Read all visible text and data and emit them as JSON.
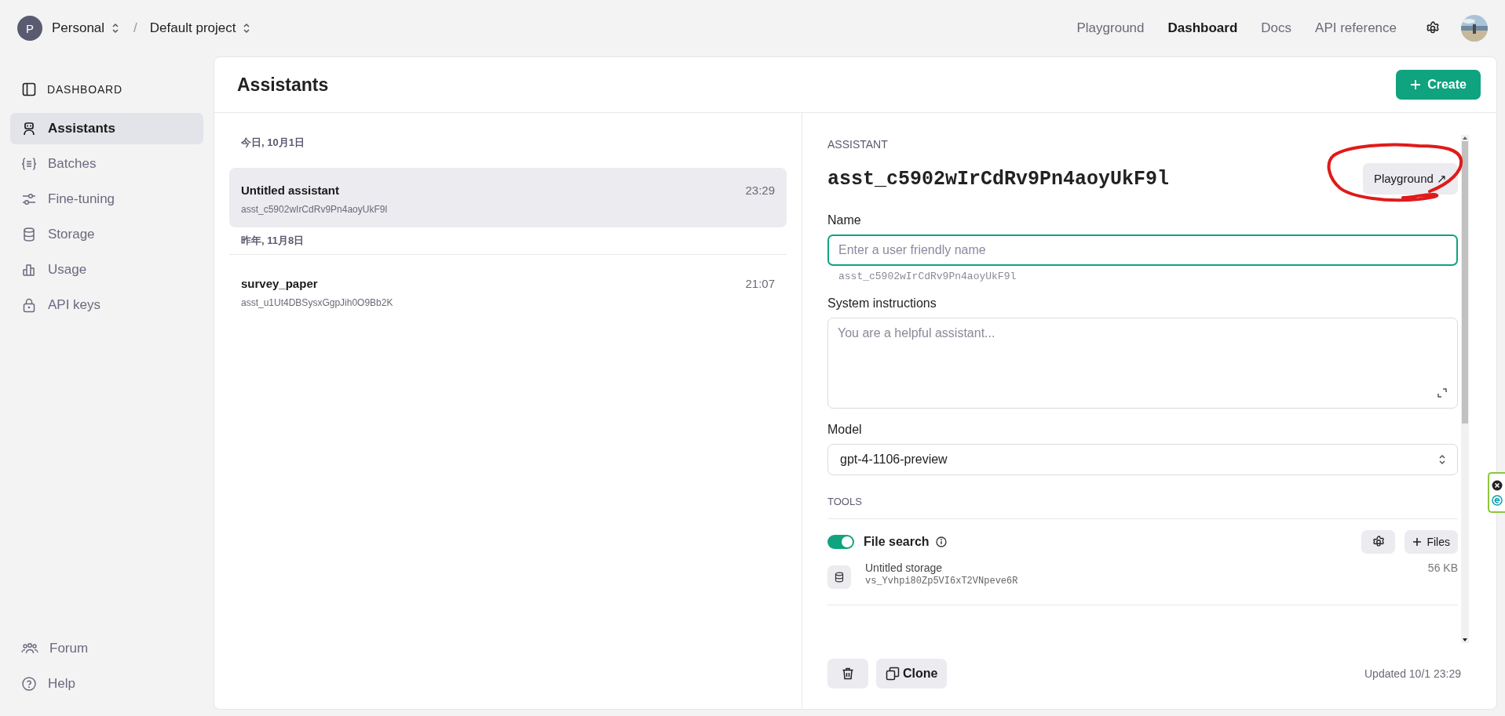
{
  "topbar": {
    "org_initial": "P",
    "org": "Personal",
    "separator": "/",
    "project": "Default project",
    "nav": [
      {
        "label": "Playground",
        "selected": false
      },
      {
        "label": "Dashboard",
        "selected": true
      },
      {
        "label": "Docs",
        "selected": false
      },
      {
        "label": "API reference",
        "selected": false
      }
    ]
  },
  "sidebar": {
    "title": "DASHBOARD",
    "items": [
      {
        "label": "Assistants",
        "selected": true
      },
      {
        "label": "Batches",
        "selected": false
      },
      {
        "label": "Fine-tuning",
        "selected": false
      },
      {
        "label": "Storage",
        "selected": false
      },
      {
        "label": "Usage",
        "selected": false
      },
      {
        "label": "API keys",
        "selected": false
      }
    ],
    "footer_items": [
      "Forum",
      "Help"
    ]
  },
  "page": {
    "title": "Assistants",
    "create_button": "Create"
  },
  "assistant_groups": [
    {
      "date": "今日, 10月1日",
      "items": [
        {
          "name": "Untitled assistant",
          "id": "asst_c5902wIrCdRv9Pn4aoyUkF9l",
          "time": "23:29",
          "selected": true
        }
      ]
    },
    {
      "date": "昨年, 11月8日",
      "items": [
        {
          "name": "survey_paper",
          "id": "asst_u1Ut4DBSysxGgpJih0O9Bb2K",
          "time": "21:07",
          "selected": false
        }
      ]
    }
  ],
  "detail": {
    "eyebrow": "ASSISTANT",
    "id": "asst_c5902wIrCdRv9Pn4aoyUkF9l",
    "playground_button": "Playground ↗",
    "name_label": "Name",
    "name_placeholder": "Enter a user friendly name",
    "name_hint": "asst_c5902wIrCdRv9Pn4aoyUkF9l",
    "instructions_label": "System instructions",
    "instructions_placeholder": "You are a helpful assistant...",
    "model_label": "Model",
    "model": "gpt-4-1106-preview",
    "tools_label": "TOOLS",
    "file_search": {
      "label": "File search",
      "on": true,
      "files_button": "Files"
    },
    "storage": {
      "name": "Untitled storage",
      "id": "vs_Yvhpi80Zp5VI6xT2VNpeve6R",
      "size": "56 KB"
    },
    "clone_button": "Clone",
    "updated": "Updated 10/1 23:29"
  }
}
